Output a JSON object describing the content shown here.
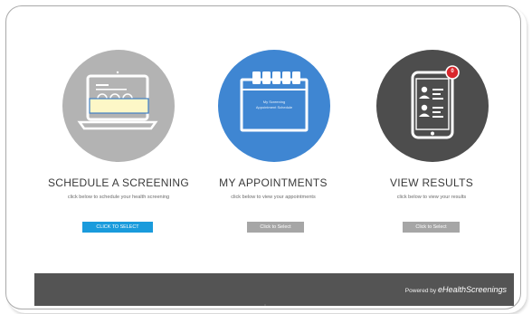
{
  "cards": [
    {
      "title": "SCHEDULE A SCREENING",
      "subtitle": "click below to schedule your health screening",
      "button_label": "CLICK TO SELECT",
      "icon": "laptop-icon",
      "circle_color": "#b3b3b3"
    },
    {
      "title": "MY APPOINTMENTS",
      "subtitle": "click below to view your appointments",
      "button_label": "Click to Select",
      "icon": "calendar-icon",
      "calendar_text_line1": "My Screening",
      "calendar_text_line2": "Appointment Schedule",
      "circle_color": "#3f86d2"
    },
    {
      "title": "VIEW RESULTS",
      "subtitle": "click below to view your results",
      "button_label": "Click to Select",
      "icon": "tablet-icon",
      "notification_count": "0",
      "circle_color": "#4d4d4d"
    }
  ],
  "footer": {
    "powered_by": "Powered by",
    "brand": "eHealthScreenings"
  },
  "colors": {
    "primary_button": "#1a9bdc",
    "secondary_button": "#a6a6a6",
    "footer": "#545454",
    "badge": "#d9262c"
  }
}
